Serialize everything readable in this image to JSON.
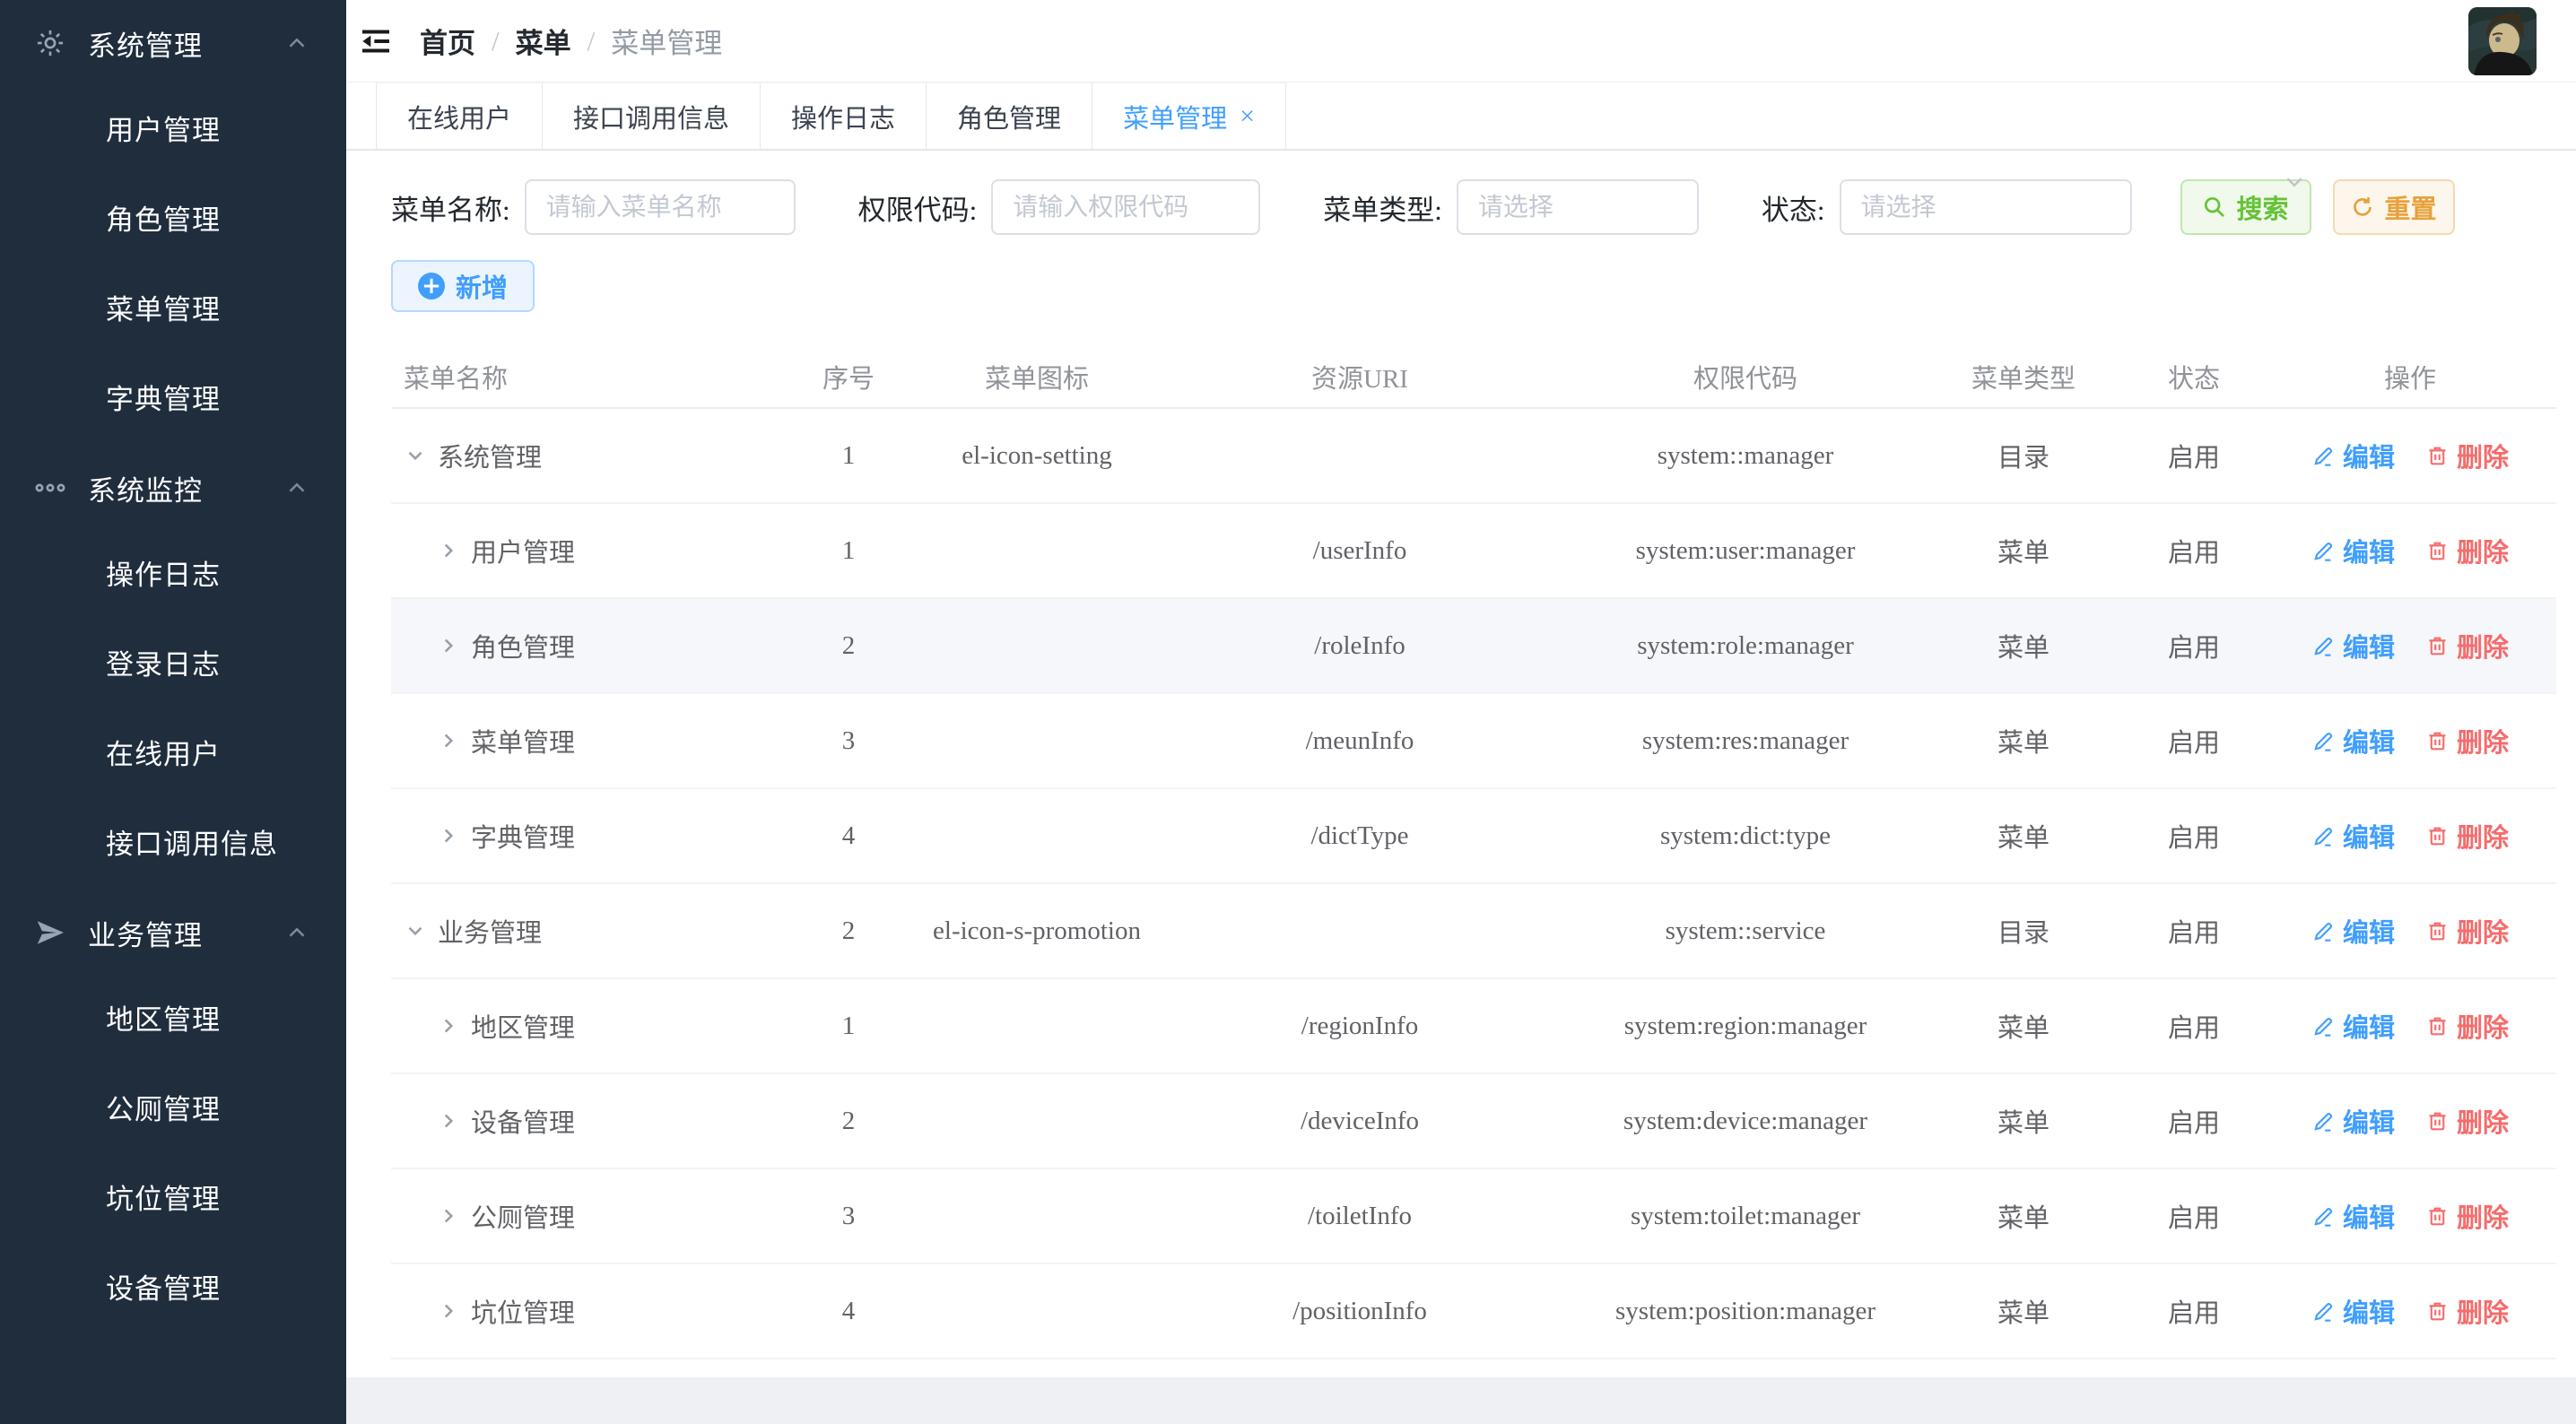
{
  "colors": {
    "accent": "#409EFF",
    "success": "#67C23A",
    "warning": "#E6A23C",
    "danger": "#F56C6C",
    "sidebar_bg": "#1f2d3d"
  },
  "sidebar": {
    "sections": [
      {
        "icon": "gear-icon",
        "label": "系统管理",
        "expanded": true,
        "children": [
          "用户管理",
          "角色管理",
          "菜单管理",
          "字典管理"
        ]
      },
      {
        "icon": "more-icon",
        "label": "系统监控",
        "expanded": true,
        "children": [
          "操作日志",
          "登录日志",
          "在线用户",
          "接口调用信息"
        ]
      },
      {
        "icon": "send-icon",
        "label": "业务管理",
        "expanded": true,
        "children": [
          "地区管理",
          "公厕管理",
          "坑位管理",
          "设备管理"
        ]
      }
    ]
  },
  "header": {
    "breadcrumb": [
      "首页",
      "菜单",
      "菜单管理"
    ]
  },
  "tabs": [
    {
      "label": "在线用户",
      "active": false,
      "closable": false
    },
    {
      "label": "接口调用信息",
      "active": false,
      "closable": false
    },
    {
      "label": "操作日志",
      "active": false,
      "closable": false
    },
    {
      "label": "角色管理",
      "active": false,
      "closable": false
    },
    {
      "label": "菜单管理",
      "active": true,
      "closable": true
    }
  ],
  "filters": {
    "fields": [
      {
        "label": "菜单名称:",
        "placeholder": "请输入菜单名称",
        "kind": "input"
      },
      {
        "label": "权限代码:",
        "placeholder": "请输入权限代码",
        "kind": "input"
      },
      {
        "label": "菜单类型:",
        "placeholder": "请选择",
        "kind": "select"
      },
      {
        "label": "状态:",
        "placeholder": "请选择",
        "kind": "select"
      }
    ],
    "search_label": "搜索",
    "reset_label": "重置",
    "add_label": "新增"
  },
  "table": {
    "columns": [
      "菜单名称",
      "序号",
      "菜单图标",
      "资源URI",
      "权限代码",
      "菜单类型",
      "状态",
      "操作"
    ],
    "edit_label": "编辑",
    "delete_label": "删除",
    "rows": [
      {
        "name": "系统管理",
        "level": 0,
        "expanded": true,
        "order": "1",
        "icon": "el-icon-setting",
        "uri": "",
        "perm": "system::manager",
        "type": "目录",
        "status": "启用",
        "highlighted": false
      },
      {
        "name": "用户管理",
        "level": 1,
        "expanded": false,
        "order": "1",
        "icon": "",
        "uri": "/userInfo",
        "perm": "system:user:manager",
        "type": "菜单",
        "status": "启用",
        "highlighted": false
      },
      {
        "name": "角色管理",
        "level": 1,
        "expanded": false,
        "order": "2",
        "icon": "",
        "uri": "/roleInfo",
        "perm": "system:role:manager",
        "type": "菜单",
        "status": "启用",
        "highlighted": true
      },
      {
        "name": "菜单管理",
        "level": 1,
        "expanded": false,
        "order": "3",
        "icon": "",
        "uri": "/meunInfo",
        "perm": "system:res:manager",
        "type": "菜单",
        "status": "启用",
        "highlighted": false
      },
      {
        "name": "字典管理",
        "level": 1,
        "expanded": false,
        "order": "4",
        "icon": "",
        "uri": "/dictType",
        "perm": "system:dict:type",
        "type": "菜单",
        "status": "启用",
        "highlighted": false
      },
      {
        "name": "业务管理",
        "level": 0,
        "expanded": true,
        "order": "2",
        "icon": "el-icon-s-promotion",
        "uri": "",
        "perm": "system::service",
        "type": "目录",
        "status": "启用",
        "highlighted": false
      },
      {
        "name": "地区管理",
        "level": 1,
        "expanded": false,
        "order": "1",
        "icon": "",
        "uri": "/regionInfo",
        "perm": "system:region:manager",
        "type": "菜单",
        "status": "启用",
        "highlighted": false
      },
      {
        "name": "设备管理",
        "level": 1,
        "expanded": false,
        "order": "2",
        "icon": "",
        "uri": "/deviceInfo",
        "perm": "system:device:manager",
        "type": "菜单",
        "status": "启用",
        "highlighted": false
      },
      {
        "name": "公厕管理",
        "level": 1,
        "expanded": false,
        "order": "3",
        "icon": "",
        "uri": "/toiletInfo",
        "perm": "system:toilet:manager",
        "type": "菜单",
        "status": "启用",
        "highlighted": false
      },
      {
        "name": "坑位管理",
        "level": 1,
        "expanded": false,
        "order": "4",
        "icon": "",
        "uri": "/positionInfo",
        "perm": "system:position:manager",
        "type": "菜单",
        "status": "启用",
        "highlighted": false
      }
    ]
  }
}
